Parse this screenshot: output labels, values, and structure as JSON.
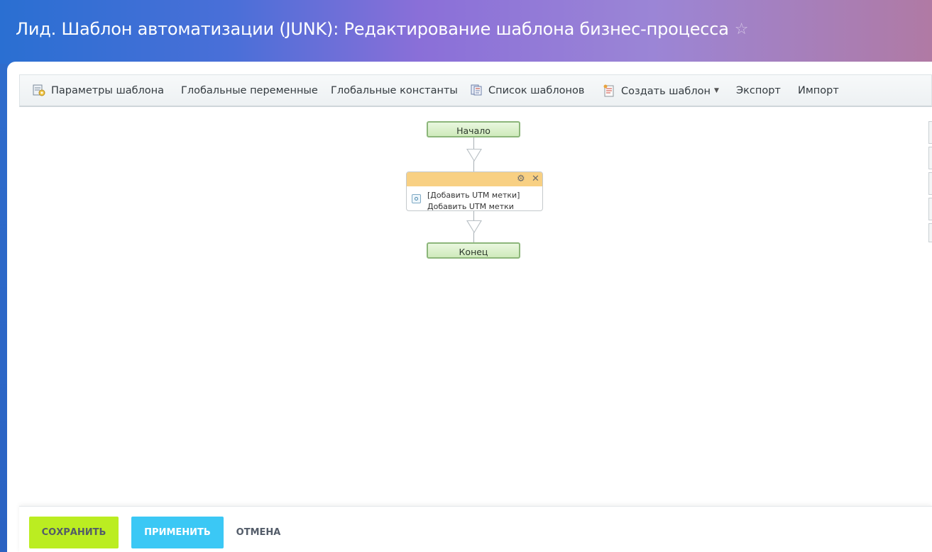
{
  "header": {
    "title": "Лид. Шаблон автоматизации (JUNK): Редактирование шаблона бизнес-процесса",
    "star_icon": "☆"
  },
  "toolbar": {
    "items": [
      {
        "label": "Параметры шаблона",
        "icon": "template-settings-icon"
      },
      {
        "label": "Глобальные переменные"
      },
      {
        "label": "Глобальные константы"
      },
      {
        "label": "Список шаблонов",
        "icon": "template-list-icon"
      },
      {
        "label": "Создать шаблон",
        "icon": "create-template-icon",
        "dropdown": true
      },
      {
        "label": "Экспорт"
      },
      {
        "label": "Импорт"
      }
    ]
  },
  "diagram": {
    "start_label": "Начало",
    "end_label": "Конец",
    "activity": {
      "title_line": "[Добавить UTM метки]",
      "subtitle_line": "Добавить UTM метки",
      "settings_icon": "⚙",
      "close_icon": "✕"
    }
  },
  "footer": {
    "save_label": "СОХРАНИТЬ",
    "apply_label": "ПРИМЕНИТЬ",
    "cancel_label": "ОТМЕНА"
  },
  "colors": {
    "save_button": "#bbed21",
    "apply_button": "#3bc8f5",
    "activity_header": "#f8d083",
    "terminal_node": "#cfeabb"
  }
}
